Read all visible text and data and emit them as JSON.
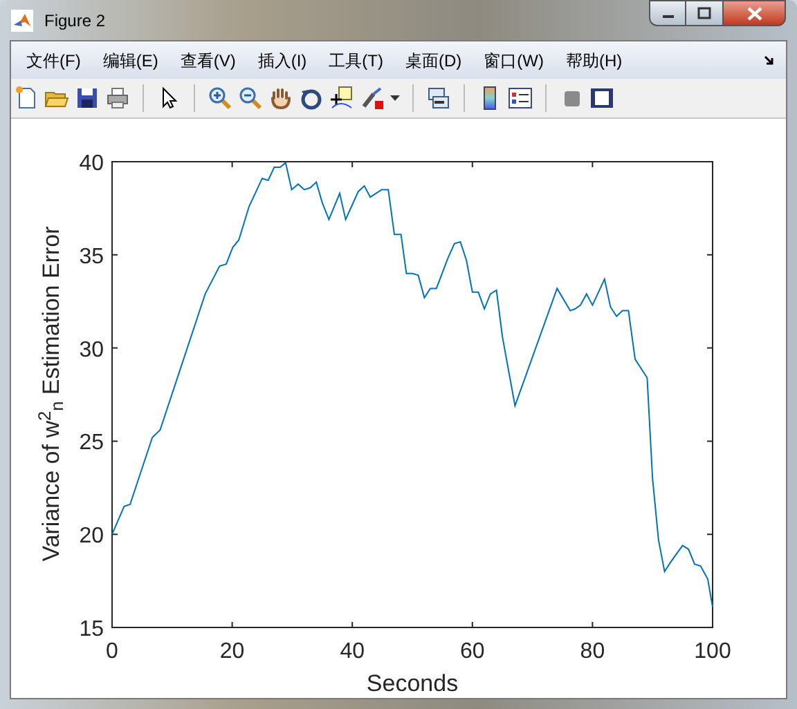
{
  "window": {
    "title": "Figure 2"
  },
  "menu": [
    "文件(F)",
    "编辑(E)",
    "查看(V)",
    "插入(I)",
    "工具(T)",
    "桌面(D)",
    "窗口(W)",
    "帮助(H)"
  ],
  "figure": {
    "chart_data": {
      "type": "line",
      "xlabel": "Seconds",
      "ylabel": "Variance of w$^{2}$$_{n}$ Estimation Error",
      "xlim": [
        0,
        100
      ],
      "ylim": [
        15,
        40
      ],
      "xticks": [
        0,
        20,
        40,
        60,
        80,
        100
      ],
      "yticks": [
        15,
        20,
        25,
        30,
        35,
        40
      ],
      "x": [
        0,
        2,
        3,
        6.7,
        8,
        15.5,
        17.9,
        19,
        20.1,
        21.1,
        22.8,
        25,
        26,
        27,
        28,
        28.9,
        29.9,
        31,
        32,
        33,
        34,
        35,
        36.1,
        37.9,
        38.9,
        41,
        42,
        43,
        44.9,
        46,
        47,
        48.1,
        49,
        50,
        51,
        52,
        53,
        54,
        55.9,
        57,
        58,
        59,
        60,
        61,
        62,
        63,
        64,
        65,
        67.1,
        74.1,
        76.3,
        77.1,
        78,
        79,
        80,
        82,
        83,
        84,
        85,
        86,
        87.1,
        89.1,
        90,
        91,
        92,
        93,
        95,
        96,
        97,
        98,
        99.2,
        100
      ],
      "series": [
        {
          "color": "#0072bd",
          "values": [
            20.0,
            21.5,
            21.6,
            25.2,
            25.6,
            32.9,
            34.4,
            34.5,
            35.4,
            35.8,
            37.6,
            39.1,
            39.0,
            39.7,
            39.7,
            39.95,
            38.5,
            38.8,
            38.5,
            38.6,
            38.9,
            37.8,
            36.9,
            38.3,
            36.9,
            38.4,
            38.7,
            38.1,
            38.5,
            38.5,
            36.1,
            36.1,
            34.0,
            34.0,
            33.9,
            32.7,
            33.2,
            33.2,
            34.8,
            35.6,
            35.7,
            34.7,
            33.0,
            33.0,
            32.1,
            32.9,
            33.1,
            30.6,
            26.9,
            33.2,
            32.0,
            32.1,
            32.3,
            32.9,
            32.3,
            33.7,
            32.2,
            31.7,
            32.0,
            32.0,
            29.4,
            28.4,
            23.0,
            19.7,
            18.0,
            18.5,
            19.4,
            19.2,
            18.4,
            18.3,
            17.6,
            16.1
          ]
        }
      ]
    }
  }
}
